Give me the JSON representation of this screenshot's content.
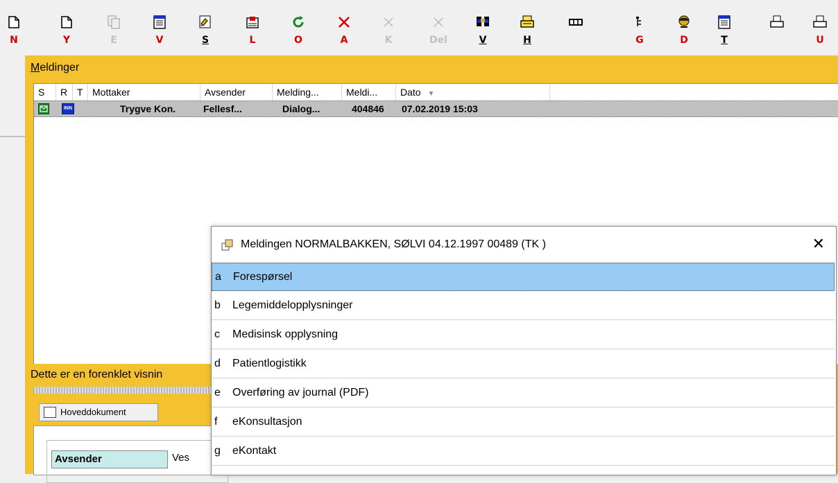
{
  "toolbar": {
    "buttons": [
      {
        "icon": "new-document-icon",
        "key": "N"
      },
      {
        "icon": "new-document-icon",
        "key": "Y"
      },
      {
        "icon": "copy-document-icon",
        "key": "E"
      },
      {
        "icon": "notepad-icon",
        "key": "V"
      },
      {
        "icon": "sign-icon",
        "key": "S"
      },
      {
        "icon": "send-icon",
        "key": "L"
      },
      {
        "icon": "refresh-icon",
        "key": "O"
      },
      {
        "icon": "cancel-icon",
        "key": "A"
      },
      {
        "icon": "cancel-disabled-icon",
        "key": "K"
      },
      {
        "icon": "delete-disabled-icon",
        "key": "Del"
      },
      {
        "icon": "binoculars-icon",
        "key": "V"
      },
      {
        "icon": "printer-document-icon",
        "key": "H"
      },
      {
        "icon": "panel-icon",
        "key": ""
      },
      {
        "icon": "tree-icon",
        "key": "G"
      },
      {
        "icon": "person-icon",
        "key": "D"
      },
      {
        "icon": "notepad-icon",
        "key": "T"
      },
      {
        "icon": "printer-icon",
        "key": ""
      },
      {
        "icon": "printer-icon",
        "key": "U"
      }
    ]
  },
  "meldinger": {
    "title_underlined": "M",
    "title_rest": "eldinger",
    "columns": [
      "S",
      "R",
      "T",
      "Mottaker",
      "Avsender",
      "Melding...",
      "Meldi...",
      "Dato"
    ],
    "row": {
      "s_icon": "envelope-icon",
      "r_badge": "INN",
      "mottaker": "Trygve Kon.",
      "avsender": "Fellesf...",
      "melding": "Dialog...",
      "meldi": "404846",
      "dato": "07.02.2019 15:03"
    }
  },
  "info_text": "Dette er en forenklet visnin",
  "tab_label": "Hoveddokument",
  "document": {
    "avsender_label": "Avsender",
    "avsender_value": "Ves"
  },
  "popup": {
    "title": "Meldingen NORMALBAKKEN, SØLVI 04.12.1997 00489 (TK )",
    "close_glyph": "✕",
    "options": [
      {
        "letter": "a",
        "label": "Forespørsel"
      },
      {
        "letter": "b",
        "label": "Legemiddelopplysninger"
      },
      {
        "letter": "c",
        "label": "Medisinsk opplysning"
      },
      {
        "letter": "d",
        "label": "Patientlogistikk"
      },
      {
        "letter": "e",
        "label": "Overføring av journal (PDF)"
      },
      {
        "letter": "f",
        "label": "eKonsultasjon"
      },
      {
        "letter": "g",
        "label": "eKontakt"
      }
    ]
  },
  "colors": {
    "panel_yellow": "#f5c22f",
    "selected_row": "#c0c0c0",
    "popup_selection": "#99ccf5",
    "key_red": "#d40000"
  }
}
